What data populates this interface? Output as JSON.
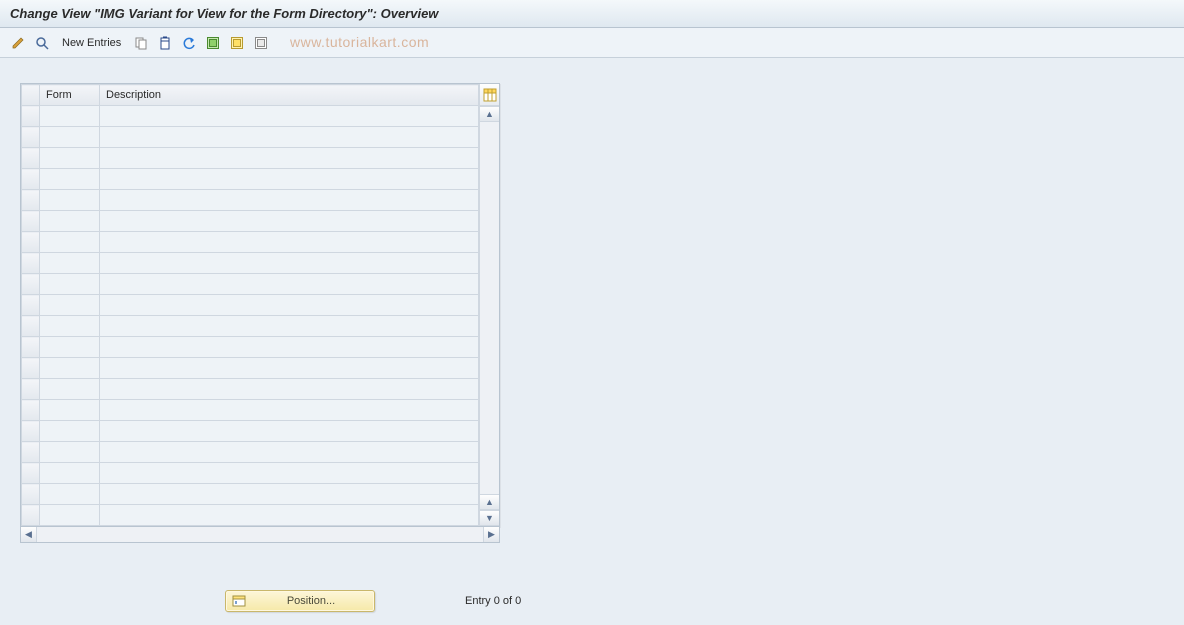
{
  "titlebar": {
    "title": "Change View \"IMG Variant for View for the Form Directory\": Overview"
  },
  "toolbar": {
    "new_entries_label": "New Entries"
  },
  "watermark": "www.tutorialkart.com",
  "table": {
    "columns": {
      "form": "Form",
      "description": "Description"
    },
    "row_count": 20
  },
  "footer": {
    "position_label": "Position...",
    "entry_text": "Entry 0 of 0"
  }
}
